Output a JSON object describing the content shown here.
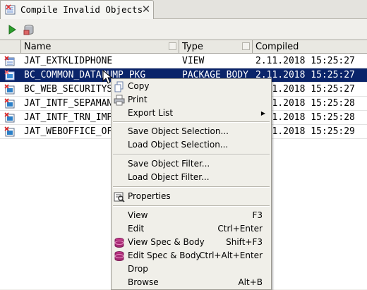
{
  "tab": {
    "title": "Compile Invalid Objects",
    "close_glyph": "✕"
  },
  "toolbar": {
    "buttons": [
      {
        "icon": "run-icon"
      },
      {
        "icon": "database-icon"
      }
    ]
  },
  "table": {
    "columns": [
      "Name",
      "Type",
      "Compiled"
    ],
    "rows": [
      {
        "icon": "view-icon",
        "name": "JAT_EXTKLIDPHONE",
        "type": "VIEW",
        "compiled": "2.11.2018 15:25:27",
        "selected": false
      },
      {
        "icon": "package-body-icon",
        "name": "BC_COMMON_DATAPUMP_PKG",
        "type": "PACKAGE BODY",
        "compiled": "2.11.2018 15:25:27",
        "selected": true
      },
      {
        "icon": "package-body-icon",
        "name": "BC_WEB_SECURITYS",
        "type": "",
        "compiled": "2.11.2018 15:25:27",
        "selected": false
      },
      {
        "icon": "package-body-icon",
        "name": "JAT_INTF_SEPAMAN",
        "type": "",
        "compiled": "2.11.2018 15:25:28",
        "selected": false
      },
      {
        "icon": "package-body-icon",
        "name": "JAT_INTF_TRN_IMP",
        "type": "",
        "compiled": "2.11.2018 15:25:28",
        "selected": false
      },
      {
        "icon": "package-body-icon",
        "name": "JAT_WEBOFFICE_OF",
        "type": "",
        "compiled": "2.11.2018 15:25:29",
        "selected": false
      }
    ]
  },
  "menu": {
    "items": [
      {
        "label": "Copy",
        "shortcut": "",
        "icon": "copy-icon",
        "submenu": false
      },
      {
        "label": "Print",
        "shortcut": "",
        "icon": "print-icon",
        "submenu": false
      },
      {
        "label": "Export List",
        "shortcut": "",
        "icon": "",
        "submenu": true
      },
      {
        "label": "Save Object Selection...",
        "shortcut": "",
        "icon": "",
        "submenu": false
      },
      {
        "label": "Load Object Selection...",
        "shortcut": "",
        "icon": "",
        "submenu": false
      },
      {
        "label": "Save Object Filter...",
        "shortcut": "",
        "icon": "",
        "submenu": false
      },
      {
        "label": "Load Object Filter...",
        "shortcut": "",
        "icon": "",
        "submenu": false
      },
      {
        "label": "Properties",
        "shortcut": "",
        "icon": "properties-icon",
        "submenu": false
      },
      {
        "label": "View",
        "shortcut": "F3",
        "icon": "",
        "submenu": false
      },
      {
        "label": "Edit",
        "shortcut": "Ctrl+Enter",
        "icon": "",
        "submenu": false
      },
      {
        "label": "View Spec & Body",
        "shortcut": "Shift+F3",
        "icon": "spec-body-icon",
        "submenu": false
      },
      {
        "label": "Edit Spec & Body",
        "shortcut": "Ctrl+Alt+Enter",
        "icon": "spec-body-icon",
        "submenu": false
      },
      {
        "label": "Drop",
        "shortcut": "",
        "icon": "",
        "submenu": false
      },
      {
        "label": "Browse",
        "shortcut": "Alt+B",
        "icon": "",
        "submenu": false
      }
    ]
  },
  "colors": {
    "selection": "#0a246a",
    "menu_bg": "#f0efe9",
    "header_bg": "#e9e8e2"
  }
}
